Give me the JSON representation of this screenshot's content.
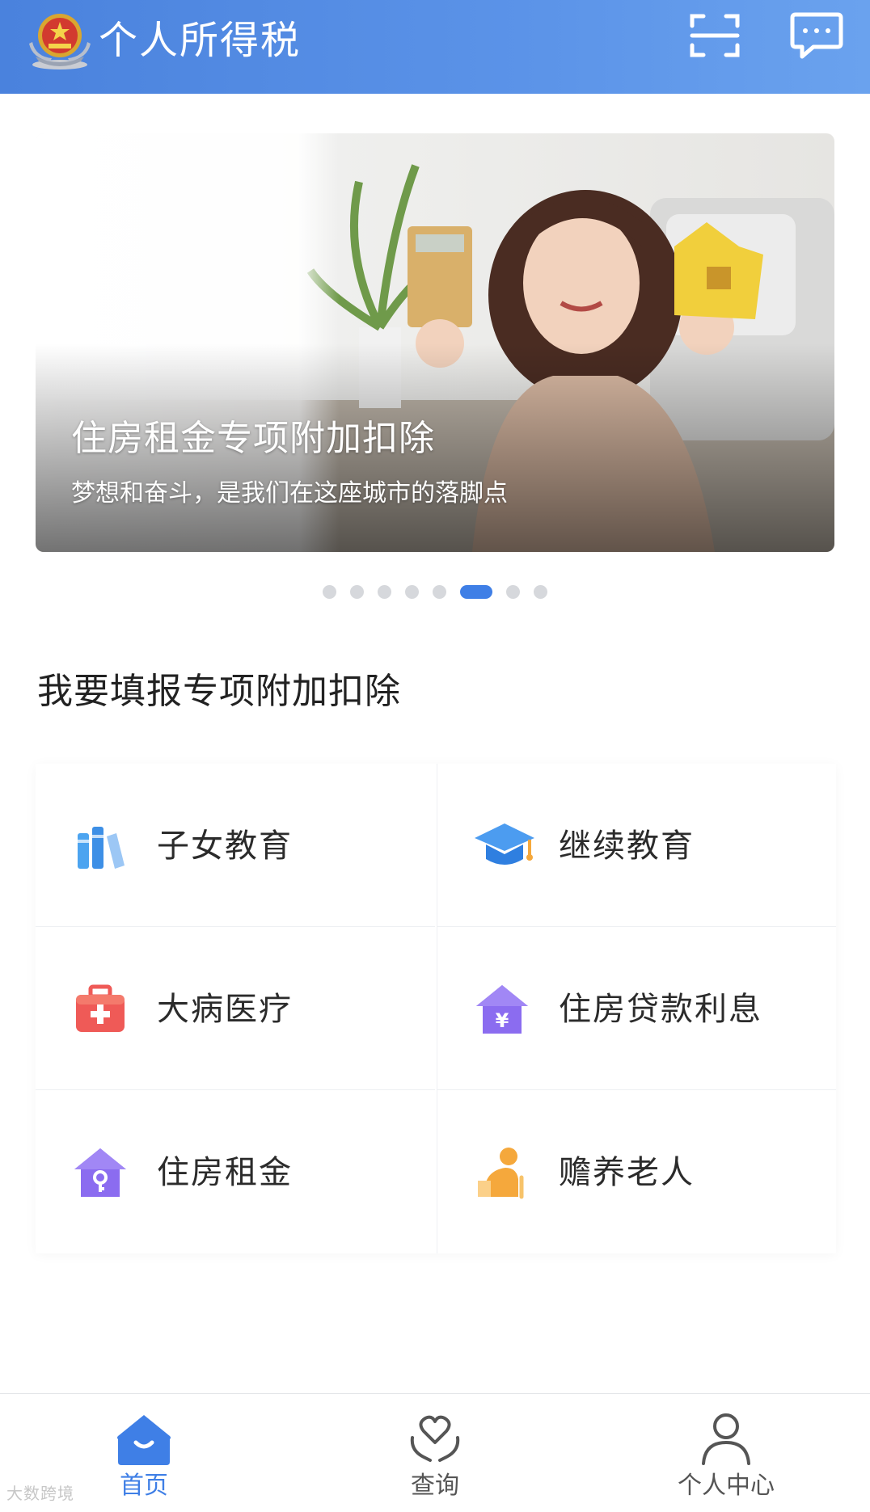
{
  "header": {
    "title": "个人所得税",
    "icons": [
      "tax-emblem-icon",
      "scan-icon",
      "message-icon"
    ],
    "background_color": "#4a82dd"
  },
  "banner": {
    "title": "住房租金专项附加扣除",
    "subtitle": "梦想和奋斗，是我们在这座城市的落脚点",
    "dots_total": 8,
    "active_dot": 6
  },
  "section": {
    "title": "我要填报专项附加扣除"
  },
  "items": [
    {
      "label": "子女教育",
      "icon": "books-icon",
      "color": "#4ca4f0"
    },
    {
      "label": "继续教育",
      "icon": "graduation-cap-icon",
      "color": "#3f8be8"
    },
    {
      "label": "大病医疗",
      "icon": "medical-kit-icon",
      "color": "#ef5a57"
    },
    {
      "label": "住房贷款利息",
      "icon": "house-yuan-icon",
      "color": "#8b6cf0"
    },
    {
      "label": "住房租金",
      "icon": "house-key-icon",
      "color": "#8b6cf0"
    },
    {
      "label": "赡养老人",
      "icon": "elderly-person-icon",
      "color": "#f5a83c"
    }
  ],
  "nav": [
    {
      "label": "首页",
      "icon": "home-icon",
      "active": true
    },
    {
      "label": "查询",
      "icon": "heart-hands-icon",
      "active": false
    },
    {
      "label": "个人中心",
      "icon": "person-icon",
      "active": false
    }
  ],
  "accent_color": "#3f7fe6",
  "watermark": "大数跨境"
}
